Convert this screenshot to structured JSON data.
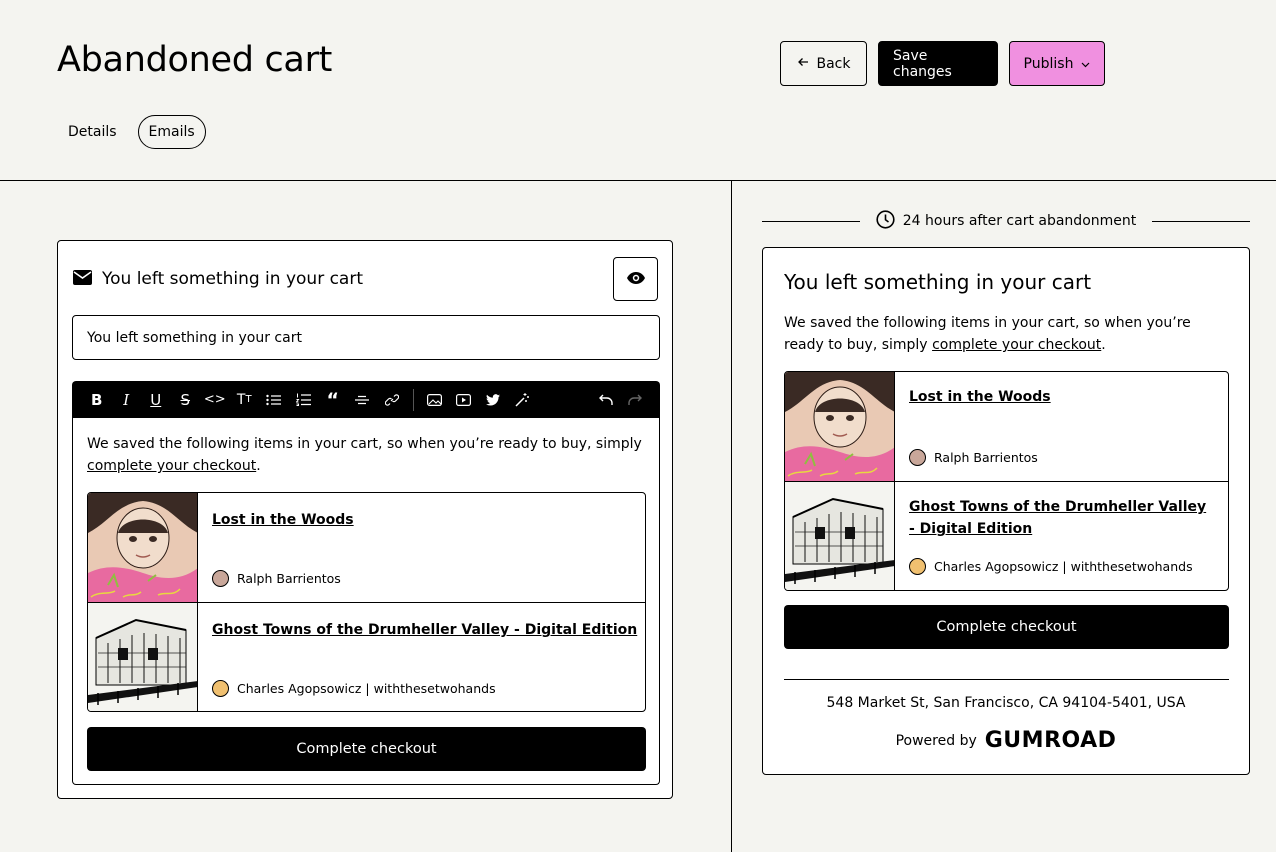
{
  "header": {
    "title": "Abandoned cart",
    "back_label": "Back",
    "save_label": "Save changes",
    "publish_label": "Publish",
    "tabs": [
      {
        "label": "Details",
        "active": false
      },
      {
        "label": "Emails",
        "active": true
      }
    ]
  },
  "editor": {
    "heading": "You left something in your cart",
    "subject_value": "You left something in your cart",
    "body_text": "We saved the following items in your cart, so when you’re ready to buy, simply",
    "body_link": "complete your checkout",
    "body_end": ".",
    "checkout_label": "Complete checkout"
  },
  "products": [
    {
      "name": "Lost in the Woods",
      "creator": "Ralph Barrientos"
    },
    {
      "name": "Ghost Towns of the Drumheller Valley - Digital Edition",
      "creator": "Charles Agopsowicz | withthesetwohands"
    }
  ],
  "preview": {
    "timing": "24 hours after cart abandonment",
    "title": "You left something in your cart",
    "body_text": "We saved the following items in your cart, so when you’re ready to buy, simply",
    "body_link": "complete your checkout",
    "body_end": ".",
    "product_names": [
      "Lost in the Woods",
      "Ghost Towns of the Drumheller Valley - Digital Edition"
    ],
    "checkout_label": "Complete checkout",
    "address": "548 Market St, San Francisco, CA 94104-5401, USA",
    "powered_by": "Powered by",
    "brand": "GUMROAD"
  },
  "colors": {
    "background": "#f4f4f0",
    "publish": "#f090e0",
    "ink": "#000000"
  },
  "icons": [
    "arrow-left-icon",
    "chevron-down-icon",
    "envelope-icon",
    "eye-icon",
    "clock-icon"
  ]
}
